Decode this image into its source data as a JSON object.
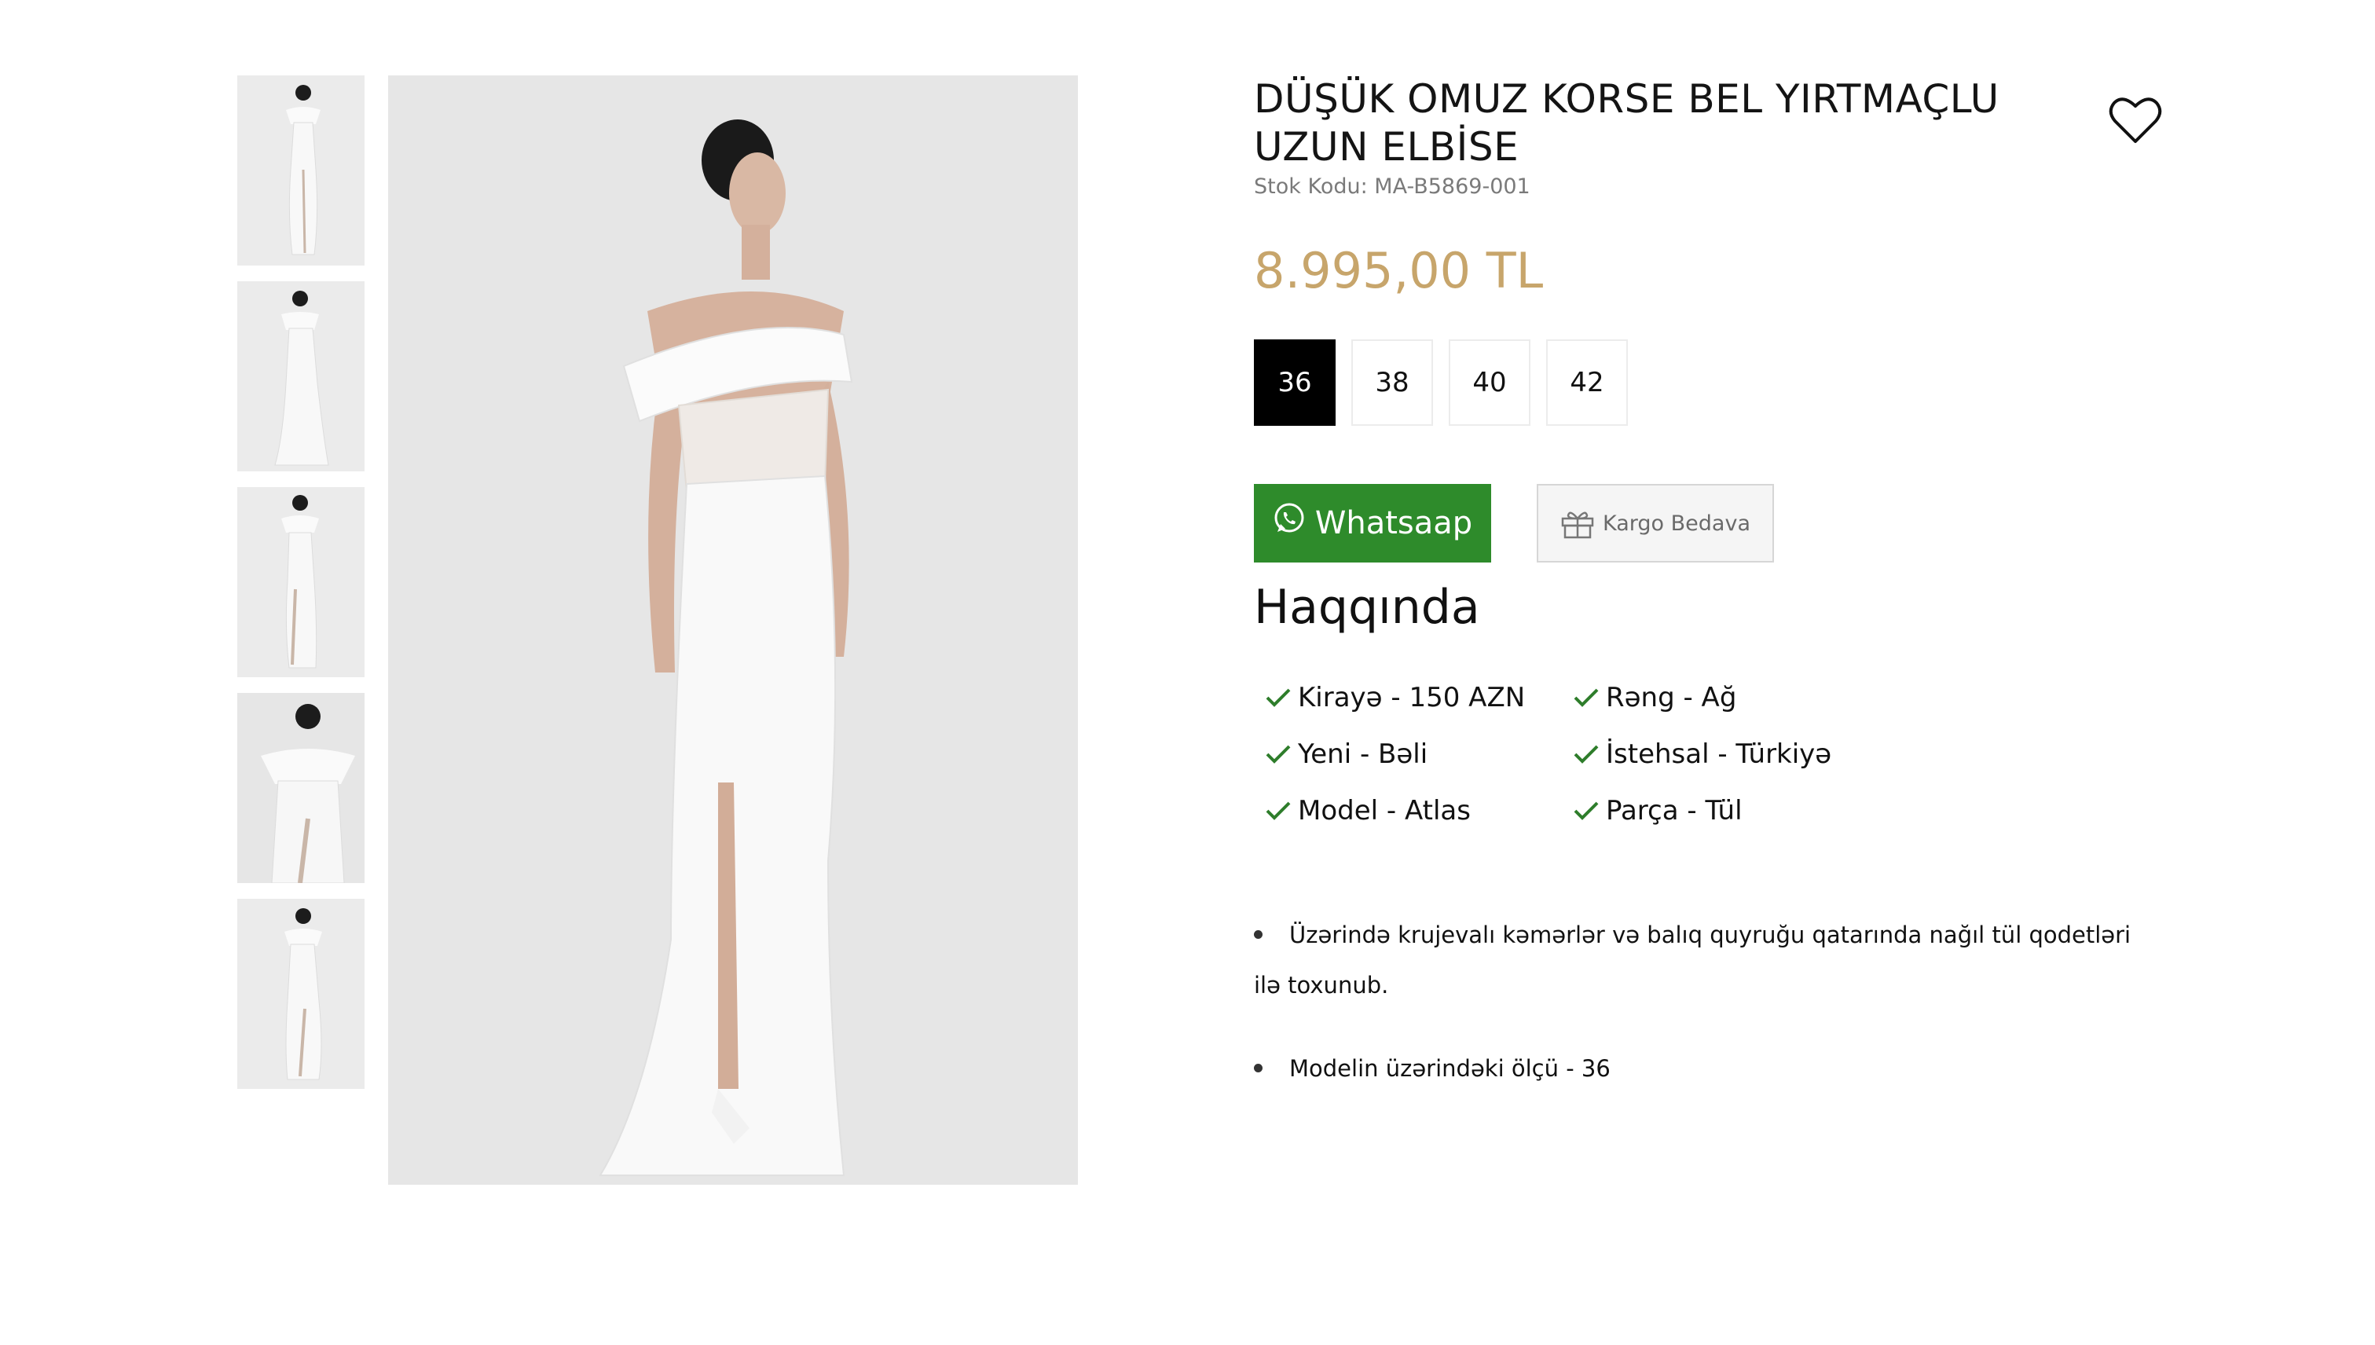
{
  "product": {
    "title": "DÜŞÜK OMUZ KORSE BEL YIRTMAÇLU UZUN ELBİSE",
    "sku": "Stok Kodu: MA-B5869-001",
    "price": "8.995,00 TL",
    "price_color": "#c7a56b"
  },
  "gallery": {
    "thumbnail_count": 5,
    "selected_index": 0
  },
  "sizes": {
    "options": [
      "36",
      "38",
      "40",
      "42"
    ],
    "selected": "36"
  },
  "actions": {
    "whatsapp_label": "Whatsaap",
    "whatsapp_color": "#2e8b2b",
    "shipping_label": "Kargo Bedava"
  },
  "about": {
    "heading": "Haqqında",
    "attributes": [
      "Kirayə - 150 AZN",
      "Rəng - Ağ",
      "Yeni - Bəli",
      "İstehsal - Türkiyə",
      "Model - Atlas",
      "Parça - Tül"
    ],
    "description": [
      "Üzərində krujevalı kəmərlər və balıq quyruğu qatarında nağıl tül qodetləri ilə toxunub.",
      "Modelin üzərindəki ölçü - 36"
    ]
  },
  "icons": {
    "wishlist": "heart-icon",
    "whatsapp": "whatsapp-icon",
    "shipping": "gift-icon",
    "attribute": "check-icon"
  }
}
